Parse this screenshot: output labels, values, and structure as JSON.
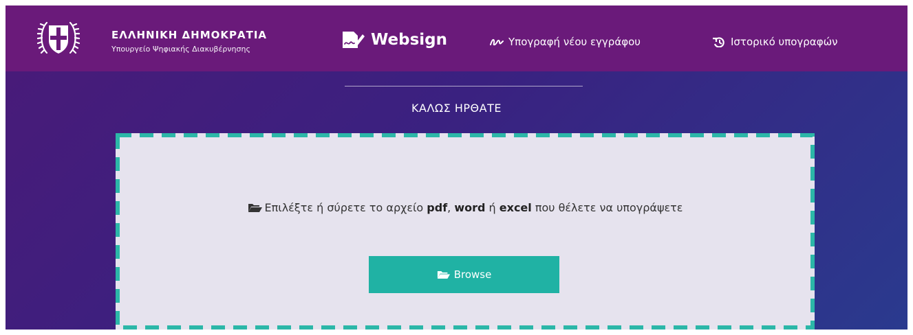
{
  "header": {
    "gov_name": "ΕΛΛΗΝΙΚΗ ΔΗΜΟΚΡΑΤΙΑ",
    "ministry": "Υπουργείο Ψηφιακής Διακυβέρνησης",
    "emblem_icon": "greek-republic-emblem-icon",
    "brand": "Websign",
    "brand_icon": "signature-document-icon",
    "nav": [
      {
        "label": "Υπογραφή νέου εγγράφου",
        "icon": "signature-scribble-icon"
      },
      {
        "label": "Ιστορικό υπογραφών",
        "icon": "history-icon"
      }
    ]
  },
  "main": {
    "welcome": "ΚΑΛΩΣ ΗΡΘΑΤΕ",
    "dropzone": {
      "prompt_before": "Επιλέξτε ή σύρετε το αρχείο ",
      "fmt_pdf": "pdf",
      "sep_comma": ", ",
      "fmt_word": "word",
      "sep_or": " ή ",
      "fmt_excel": "excel",
      "prompt_after": " που θέλετε να υπογράψετε",
      "prompt_icon": "folder-open-icon",
      "browse_label": "Browse",
      "browse_icon": "folder-open-icon"
    }
  },
  "colors": {
    "header_bg": "#6a1a7a",
    "page_gradient_start": "#4a1a78",
    "page_gradient_end": "#2a3a8e",
    "accent_teal": "#20b2a4",
    "dropzone_bg": "#e6e3ee"
  }
}
